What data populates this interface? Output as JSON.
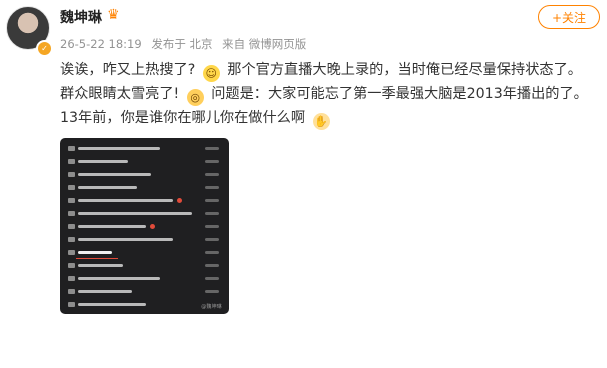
{
  "author": {
    "name": "魏坤琳"
  },
  "meta": {
    "timestamp": "26-5-22 18:19",
    "location": "发布于 北京",
    "source": "来自 微博网页版"
  },
  "follow_button": "+关注",
  "post": {
    "text_1": "诶诶，咋又上热搜了?",
    "text_2": "那个官方直播大晚上录的，当时俺已经尽量保持状态了。群众眼睛太雪亮了!",
    "text_3": "问题是：大家可能忘了第一季最强大脑是2013年播出的了。13年前，你是谁你在哪儿你在做什么啊"
  },
  "icons": {
    "verify": "verified-badge-icon",
    "vip": "vip-crown-icon",
    "emoji_1": "laughing-emoji-icon",
    "emoji_2": "shocked-emoji-icon",
    "emoji_3": "waving-emoji-icon"
  },
  "colors": {
    "accent": "#ff8200",
    "image_bg": "#1f1f21",
    "highlight": "#e14b3a"
  },
  "image_watermark": "@魏坤琳"
}
